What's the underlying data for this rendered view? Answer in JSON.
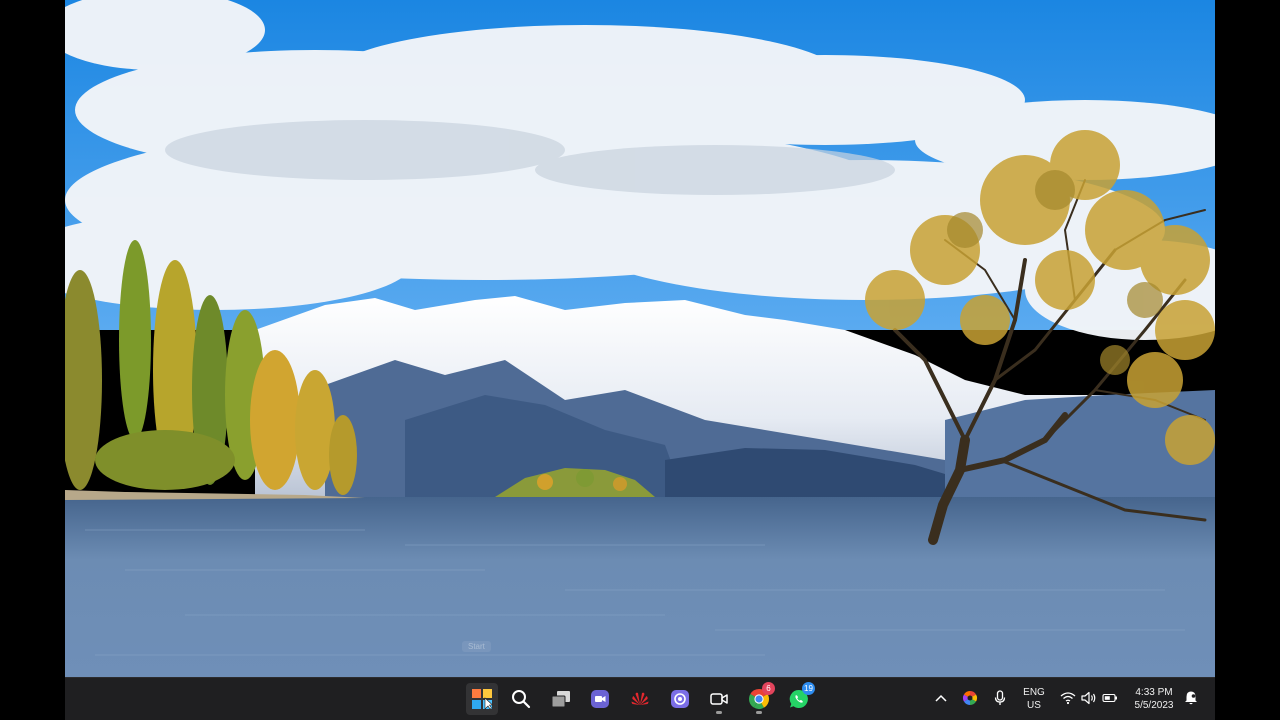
{
  "wallpaper": {
    "description_icon": "landscape-wallpaper",
    "colors": {
      "sky": "#1f8fe6",
      "cloud": "#f2f5f8",
      "snow": "#f4f6f9",
      "water": "#5b7da6",
      "foliage": "#c9a332",
      "poplar": "#b7b02c"
    }
  },
  "start_tooltip": "Start",
  "taskbar": {
    "apps": [
      {
        "icon": "windows-start-icon",
        "active": true
      },
      {
        "icon": "search-icon"
      },
      {
        "icon": "task-view-icon"
      },
      {
        "icon": "teams-chat-icon"
      },
      {
        "icon": "huawei-icon"
      },
      {
        "icon": "screen-recorder-icon"
      },
      {
        "icon": "zoom-icon",
        "running": true
      },
      {
        "icon": "chrome-icon",
        "badge": "6",
        "running": true
      },
      {
        "icon": "whatsapp-icon",
        "badge": "19"
      }
    ],
    "tray": {
      "overflow_icon": "chevron-up-icon",
      "language": "ENG",
      "region": "US",
      "time": "4:33 PM",
      "date": "5/5/2023"
    },
    "colors": {
      "background": "#1f1f21",
      "accent": "#4cc2ff",
      "chrome_badge": "#e2445c",
      "whatsapp_badge": "#2d8cf0"
    }
  }
}
